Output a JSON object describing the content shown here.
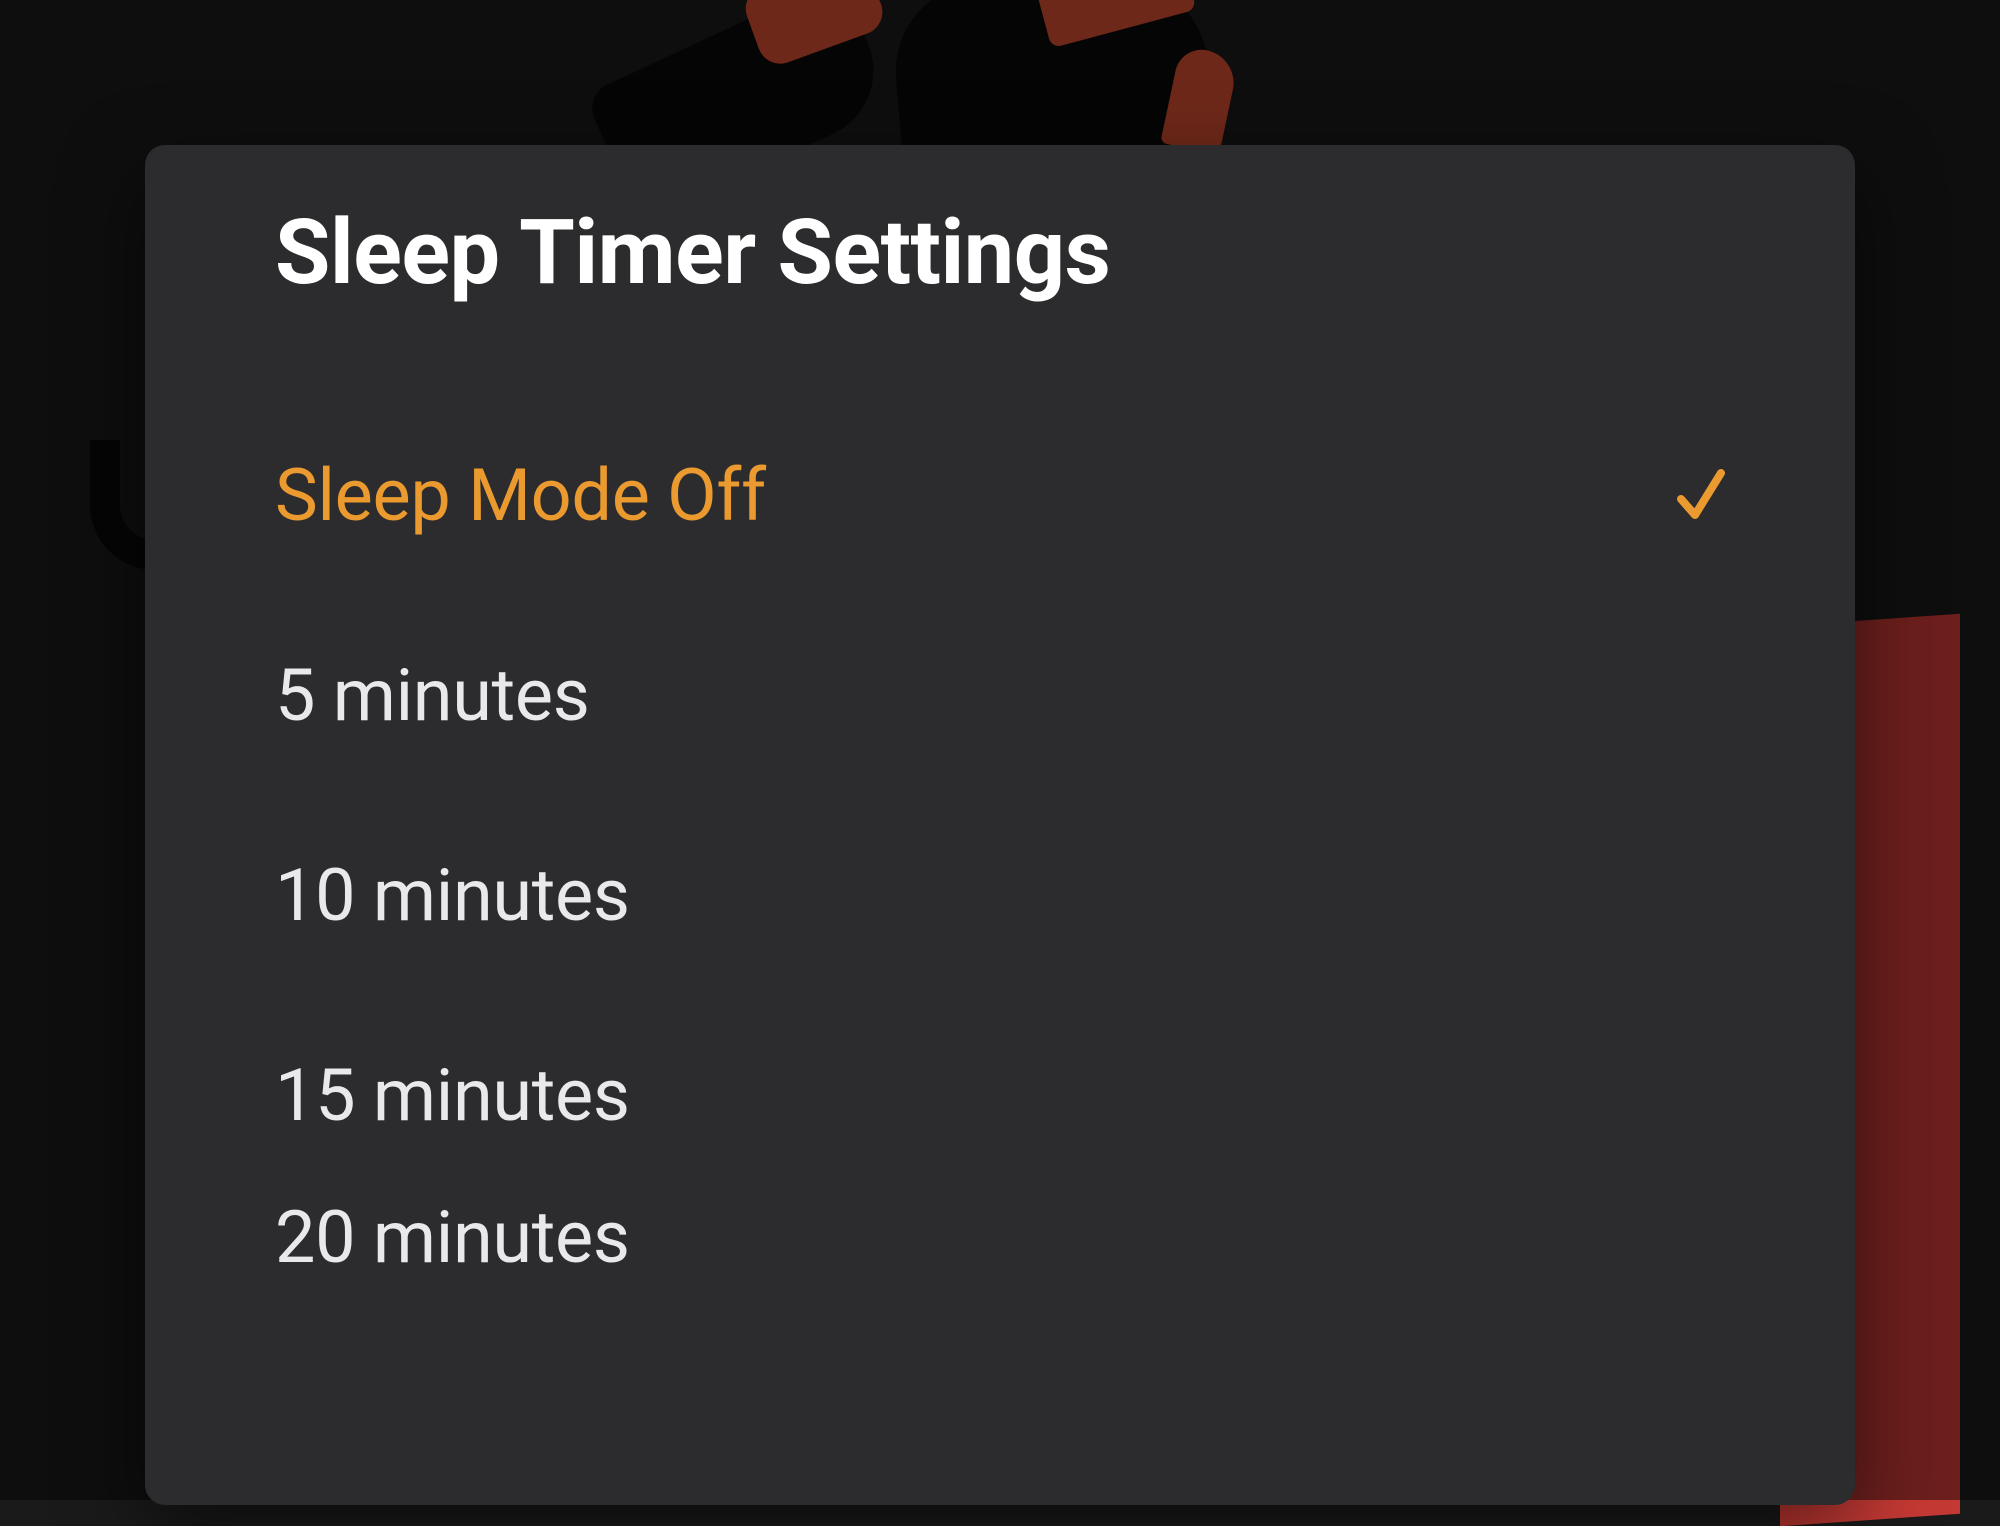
{
  "dialog": {
    "title": "Sleep Timer Settings",
    "options": [
      {
        "label": "Sleep Mode Off",
        "selected": true
      },
      {
        "label": "5 minutes",
        "selected": false
      },
      {
        "label": "10 minutes",
        "selected": false
      },
      {
        "label": "15 minutes",
        "selected": false
      },
      {
        "label": "20 minutes",
        "selected": false
      }
    ]
  },
  "colors": {
    "accent": "#eb9a2f",
    "dialogBg": "#2c2c2e",
    "textPrimary": "#ffffff",
    "textSecondary": "#e9e9ec"
  }
}
